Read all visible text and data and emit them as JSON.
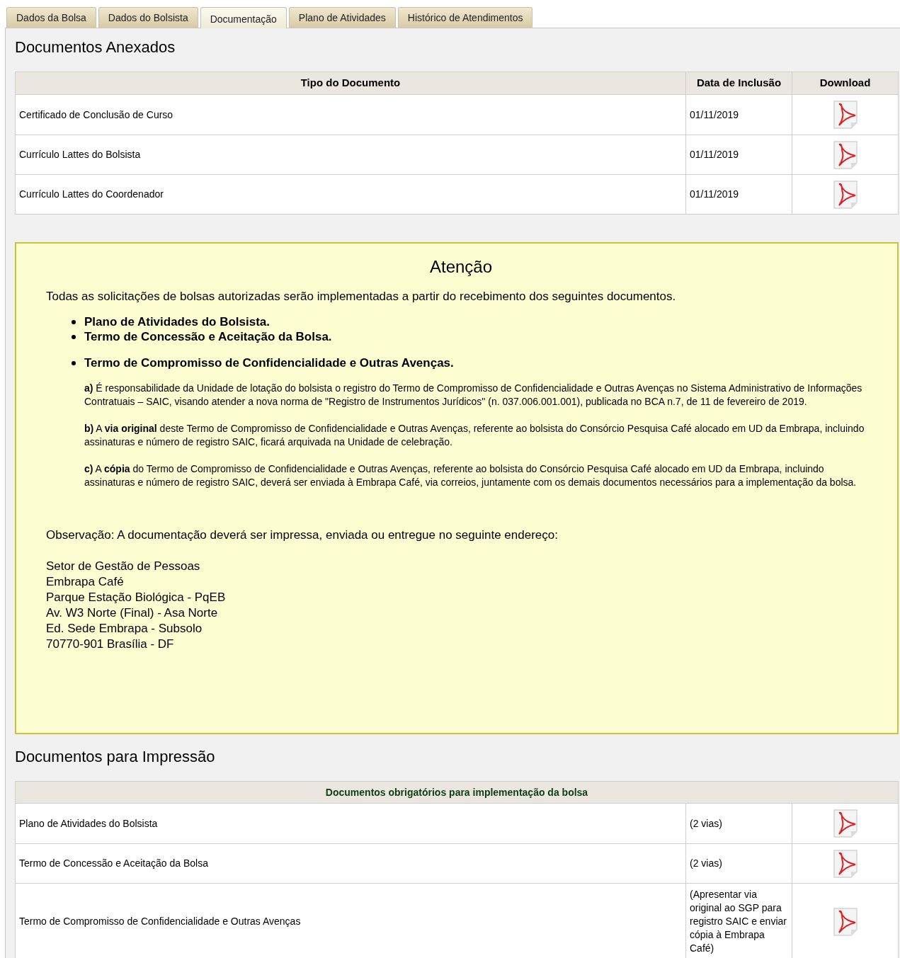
{
  "tabs": [
    {
      "label": "Dados da Bolsa",
      "selected": false
    },
    {
      "label": "Dados do Bolsista",
      "selected": false
    },
    {
      "label": "Documentação",
      "selected": true
    },
    {
      "label": "Plano de Atividades",
      "selected": false
    },
    {
      "label": "Histórico de Atendimentos",
      "selected": false
    }
  ],
  "attached": {
    "title": "Documentos Anexados",
    "columns": [
      "Tipo do Documento",
      "Data de Inclusão",
      "Download"
    ],
    "rows": [
      {
        "type": "Certificado de Conclusão de Curso",
        "date": "01/11/2019"
      },
      {
        "type": "Currículo Lattes do Bolsista",
        "date": "01/11/2019"
      },
      {
        "type": "Currículo Lattes do Coordenador",
        "date": "01/11/2019"
      }
    ]
  },
  "notice": {
    "title": "Atenção",
    "intro": "Todas as solicitações de bolsas autorizadas serão implementadas a partir do recebimento dos seguintes documentos.",
    "items": [
      "Plano de Atividades do Bolsista.",
      "Termo de Concessão e Aceitação da Bolsa.",
      "Termo de Compromisso de Confidencialidade e Outras Avenças."
    ],
    "notes": [
      "**a)** É responsabilidade da Unidade de lotação do bolsista o registro do Termo de Compromisso de Confidencialidade e Outras Avenças no Sistema Administrativo de Informações Contratuais – SAIC, visando atender a nova norma de \"Registro de Instrumentos Jurídicos\" (n. 037.006.001.001), publicada no BCA n.7, de 11 de fevereiro de 2019.",
      "**b)** A **via original** deste Termo de Compromisso de Confidencialidade e Outras Avenças, referente ao bolsista do Consórcio Pesquisa Café alocado em UD da Embrapa, incluindo assinaturas e número de registro SAIC, ficará arquivada na Unidade de celebração.",
      "**c)** A **cópia** do Termo de Compromisso de Confidencialidade e Outras Avenças, referente ao bolsista do Consórcio Pesquisa Café alocado em UD da Embrapa, incluindo assinaturas e número de registro SAIC, deverá ser enviada à Embrapa Café, via correios, juntamente com os demais documentos necessários para a implementação da bolsa."
    ],
    "observation": "Observação: A documentação deverá ser impressa, enviada ou entregue no seguinte endereço:",
    "address": [
      "Setor de Gestão de Pessoas",
      "Embrapa Café",
      "Parque Estação Biológica - PqEB",
      "Av. W3 Norte (Final) - Asa Norte",
      "Ed. Sede Embrapa - Subsolo",
      "70770-901 Brasília - DF"
    ]
  },
  "printing": {
    "title": "Documentos para Impressão",
    "header": "Documentos obrigatórios para implementação da bolsa",
    "rows": [
      {
        "name": "Plano de Atividades do Bolsista",
        "copies": "(2 vias)"
      },
      {
        "name": "Termo de Concessão e Aceitação da Bolsa",
        "copies": "(2 vias)"
      },
      {
        "name": "Termo de Compromisso de Confidencialidade e Outras Avenças",
        "copies": "(Apresentar via original ao SGP para registro SAIC e enviar cópia à Embrapa Café)"
      }
    ]
  }
}
